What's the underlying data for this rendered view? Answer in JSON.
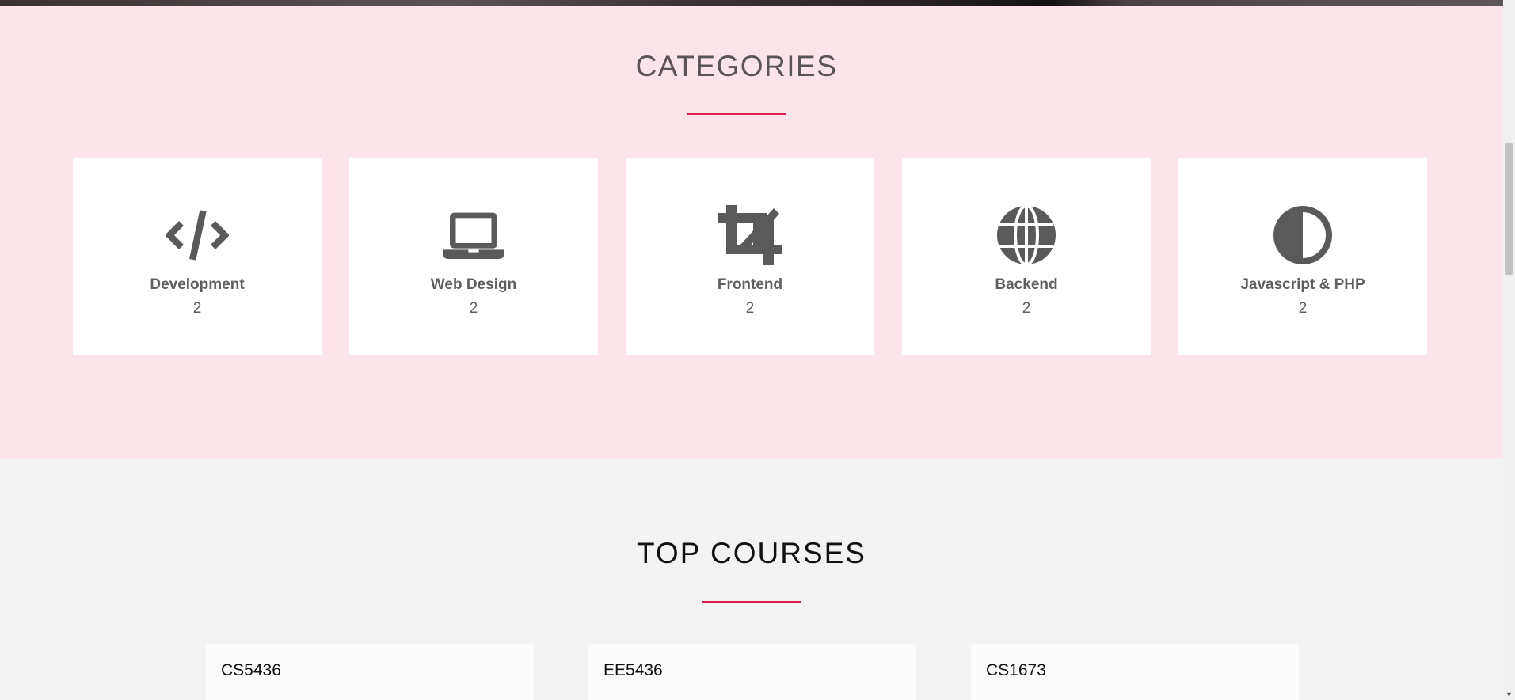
{
  "categories_section": {
    "title": "CATEGORIES",
    "items": [
      {
        "icon": "code-icon",
        "label": "Development",
        "count": "2"
      },
      {
        "icon": "laptop-icon",
        "label": "Web Design",
        "count": "2"
      },
      {
        "icon": "crop-icon",
        "label": "Frontend",
        "count": "2"
      },
      {
        "icon": "globe-icon",
        "label": "Backend",
        "count": "2"
      },
      {
        "icon": "adjust-icon",
        "label": "Javascript & PHP",
        "count": "2"
      }
    ]
  },
  "courses_section": {
    "title": "TOP COURSES",
    "items": [
      {
        "code": "CS5436"
      },
      {
        "code": "EE5436"
      },
      {
        "code": "CS1673"
      }
    ]
  },
  "colors": {
    "accent": "#dc1f4e",
    "categories_bg": "#fce4ea",
    "page_bg": "#f3f3f3",
    "icon": "#5a5a5a"
  }
}
